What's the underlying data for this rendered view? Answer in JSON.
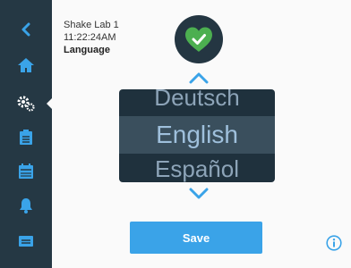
{
  "device": {
    "name": "Shake Lab 1",
    "time": "11:22:24AM"
  },
  "page": {
    "title": "Language"
  },
  "picker": {
    "previous": "Deutsch",
    "selected": "English",
    "next": "Español"
  },
  "actions": {
    "save": "Save"
  },
  "colors": {
    "sidebar": "#253844",
    "accent": "#3aa3e8",
    "status_ok": "#4caf50"
  },
  "icons": {
    "sidebar": [
      "back-icon",
      "home-icon",
      "settings-icon",
      "clipboard-icon",
      "calendar-icon",
      "bell-icon",
      "card-icon"
    ],
    "status": "heart-check-icon",
    "info": "info-icon"
  }
}
